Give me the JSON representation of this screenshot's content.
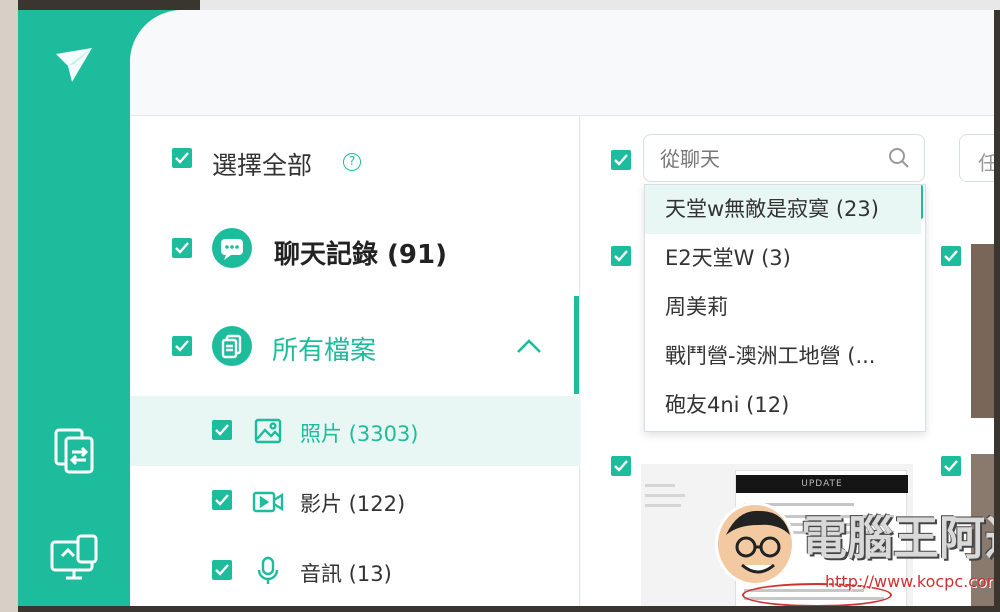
{
  "colors": {
    "accent": "#1dbc9c",
    "accent_light": "#e8f7f3",
    "text": "#333333"
  },
  "sidebar": {
    "select_all": {
      "label": "選擇全部",
      "help_icon": "question-circle-icon",
      "help_glyph": "?"
    },
    "chat_records": {
      "label": "聊天記錄 (91)",
      "icon": "chat-bubble-icon"
    },
    "all_files": {
      "label": "所有檔案",
      "icon": "files-icon",
      "expand_icon": "chevron-up-icon"
    },
    "items": [
      {
        "label": "照片 (3303)",
        "icon": "image-icon",
        "selected": true
      },
      {
        "label": "影片 (122)",
        "icon": "video-icon",
        "selected": false
      },
      {
        "label": "音訊 (13)",
        "icon": "microphone-icon",
        "selected": false
      }
    ]
  },
  "rail": {
    "logo": "app-logo-icon",
    "buttons": [
      "phone-transfer-icon",
      "pc-transfer-icon"
    ]
  },
  "search": {
    "placeholder": "從聊天",
    "icon": "search-icon"
  },
  "search2": {
    "text": "任"
  },
  "dropdown": {
    "items": [
      {
        "label": "天堂w無敵是寂寞 (23)",
        "active": true
      },
      {
        "label": "E2天堂W (3)",
        "active": false
      },
      {
        "label": "周美莉",
        "active": false
      },
      {
        "label": "戰鬥營-澳洲工地營 (...",
        "active": false
      },
      {
        "label": "砲友4ni (12)",
        "active": false
      }
    ]
  },
  "thumbnail": {
    "header": "UPDATE"
  },
  "watermark": {
    "title": "電腦王阿達",
    "url": "http://www.kocpc.com.tw"
  }
}
